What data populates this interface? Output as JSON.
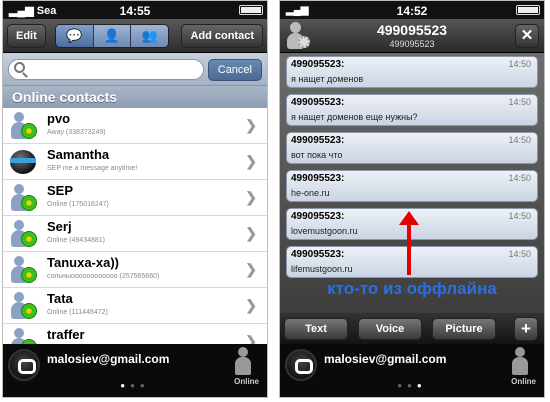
{
  "left": {
    "status": {
      "carrier": "Sea",
      "time": "14:55"
    },
    "nav": {
      "edit": "Edit",
      "add_contact": "Add contact"
    },
    "search": {
      "placeholder": "",
      "cancel": "Cancel"
    },
    "section": "Online contacts",
    "contacts": [
      {
        "name": "pvo",
        "status": "Away (338373249)",
        "icon": "icq-flower-clock-icon"
      },
      {
        "name": "Samantha",
        "status": "SEP me a message anytime!",
        "icon": "aim-buddy-icon"
      },
      {
        "name": "SEP",
        "status": "Online (175016247)",
        "icon": "icq-flower-icon"
      },
      {
        "name": "Serj",
        "status": "Online (49434881)",
        "icon": "icq-flower-icon"
      },
      {
        "name": "Tanuxa-xa))",
        "status": "сольныоооооооооооо (257565660)",
        "icon": "icq-flower-icon"
      },
      {
        "name": "Tata",
        "status": "Online (111448472)",
        "icon": "icq-flower-icon"
      },
      {
        "name": "traffer",
        "status": "",
        "icon": "icq-flower-icon"
      }
    ],
    "bottom": {
      "email": "malosiev@gmail.com",
      "status": "Online"
    }
  },
  "right": {
    "status": {
      "time": "14:52"
    },
    "title": "499095523",
    "subtitle": "499095523",
    "messages": [
      {
        "from": "499095523:",
        "time": "14:50",
        "text": "я нащет доменов"
      },
      {
        "from": "499095523:",
        "time": "14:50",
        "text": "я нащет доменов еще нужны?"
      },
      {
        "from": "499095523:",
        "time": "14:50",
        "text": "вот пока что"
      },
      {
        "from": "499095523:",
        "time": "14:50",
        "text": "he-one.ru"
      },
      {
        "from": "499095523:",
        "time": "14:50",
        "text": "lovemustgoon.ru"
      },
      {
        "from": "499095523:",
        "time": "14:50",
        "text": "lifemustgoon.ru"
      }
    ],
    "annotation": "кто-то из оффлайна",
    "actions": {
      "text": "Text",
      "voice": "Voice",
      "picture": "Picture",
      "plus": "+"
    },
    "bottom": {
      "email": "malosiev@gmail.com",
      "status": "Online"
    }
  },
  "colors": {
    "accent": "#2b6fe0",
    "arrow": "#e30000"
  }
}
